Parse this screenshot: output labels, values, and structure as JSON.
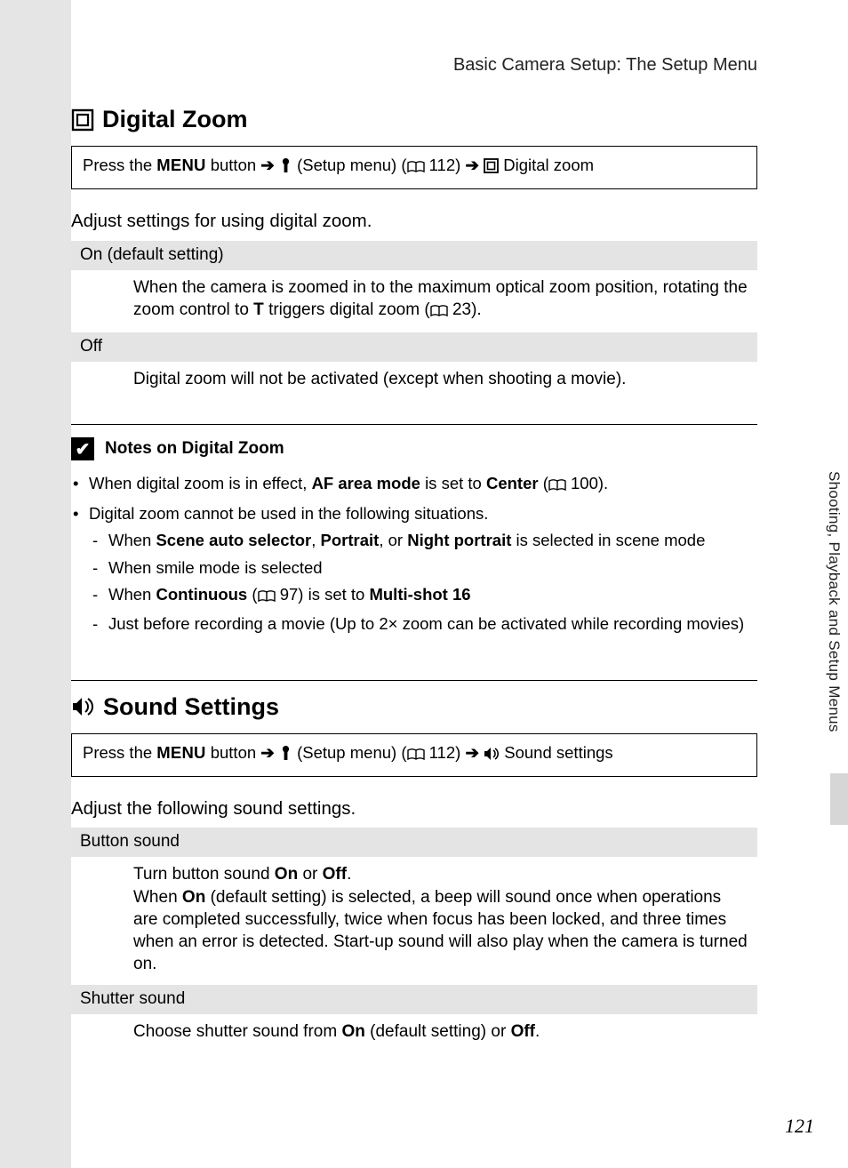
{
  "header": {
    "chapter": "Basic Camera Setup: The Setup Menu"
  },
  "side_tab": "Shooting, Playback and Setup Menus",
  "page_number": "121",
  "sections": [
    {
      "title": "Digital Zoom",
      "nav": {
        "press": "Press the ",
        "menu": "MENU",
        "button_word": " button ",
        "setup": " (Setup menu) ",
        "page_ref": " 112",
        "target": " Digital zoom"
      },
      "intro": "Adjust settings for using digital zoom.",
      "options": [
        {
          "name": "On (default setting)",
          "body_a": "When the camera is zoomed in to the maximum optical zoom position, rotating the zoom control to ",
          "bold_t": "T",
          "body_b": " triggers digital zoom ",
          "page_ref": " 23"
        },
        {
          "name": "Off",
          "body": "Digital zoom will not be activated (except when shooting a movie)."
        }
      ],
      "notes": {
        "title": "Notes on Digital Zoom",
        "items": [
          {
            "a": "When digital zoom is in effect, ",
            "b1": "AF area mode",
            "c": " is set to ",
            "b2": "Center",
            "ref": " 100"
          },
          {
            "text": "Digital zoom cannot be used in the following situations.",
            "sub": [
              {
                "a": "When ",
                "b1": "Scene auto selector",
                "b2": "Portrait",
                "m": ", or ",
                "b3": "Night portrait",
                "c": " is selected in scene mode"
              },
              {
                "text": "When smile mode is selected"
              },
              {
                "a": "When ",
                "b1": "Continuous",
                "ref": " 97",
                "m": " is set to ",
                "b2": "Multi-shot 16"
              },
              {
                "text": "Just before recording a movie (Up to 2× zoom can be activated while recording movies)"
              }
            ]
          }
        ]
      }
    },
    {
      "title": "Sound Settings",
      "nav": {
        "press": "Press the ",
        "menu": "MENU",
        "button_word": " button ",
        "setup": " (Setup menu) ",
        "page_ref": " 112",
        "target": " Sound settings"
      },
      "intro": "Adjust the following sound settings.",
      "options": [
        {
          "name": "Button sound",
          "l1a": "Turn button sound ",
          "on": "On",
          "l1b": " or ",
          "off": "Off",
          "l2a": "When ",
          "l2b": " (default setting) is selected, a beep will sound once when operations are completed successfully, twice when focus has been locked, and three times when an error is detected. Start-up sound will also play when the camera is turned on."
        },
        {
          "name": "Shutter sound",
          "a": "Choose shutter sound from ",
          "on": "On",
          "m": " (default setting) or ",
          "off": "Off"
        }
      ]
    }
  ]
}
